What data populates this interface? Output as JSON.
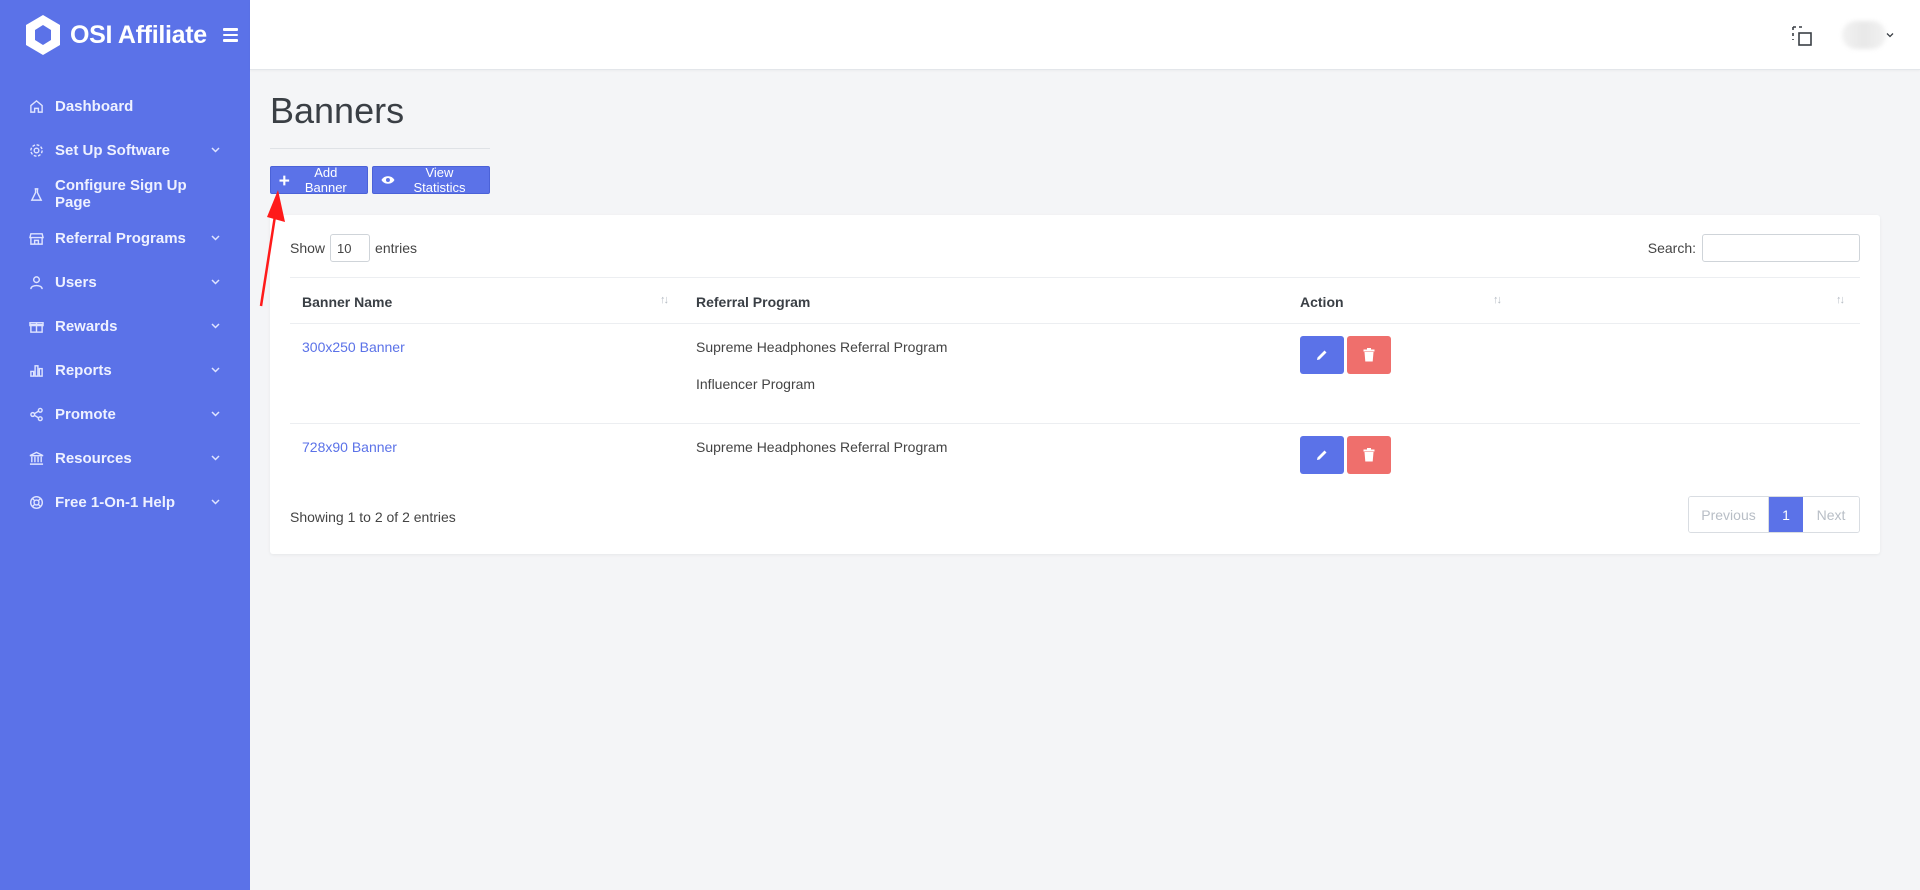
{
  "app": {
    "name": "OSI Affiliate"
  },
  "sidebar": {
    "items": [
      {
        "label": "Dashboard",
        "icon": "home-icon",
        "has_submenu": false
      },
      {
        "label": "Set Up Software",
        "icon": "gear-icon",
        "has_submenu": true
      },
      {
        "label": "Configure Sign Up Page",
        "icon": "flask-icon",
        "has_submenu": false
      },
      {
        "label": "Referral Programs",
        "icon": "store-icon",
        "has_submenu": true
      },
      {
        "label": "Users",
        "icon": "user-icon",
        "has_submenu": true
      },
      {
        "label": "Rewards",
        "icon": "gift-icon",
        "has_submenu": true
      },
      {
        "label": "Reports",
        "icon": "bar-chart-icon",
        "has_submenu": true
      },
      {
        "label": "Promote",
        "icon": "share-icon",
        "has_submenu": true
      },
      {
        "label": "Resources",
        "icon": "bank-icon",
        "has_submenu": true
      },
      {
        "label": "Free 1-On-1 Help",
        "icon": "lifebuoy-icon",
        "has_submenu": true
      }
    ]
  },
  "header": {
    "fullscreen_icon": "fullscreen-icon"
  },
  "main": {
    "title": "Banners",
    "buttons": {
      "add_banner": "Add Banner",
      "view_statistics": "View Statistics"
    },
    "table_controls": {
      "show_label": "Show",
      "entries_value": "10",
      "entries_label": "entries",
      "search_label": "Search:",
      "search_value": ""
    },
    "table": {
      "columns": [
        "Banner Name",
        "Referral Program",
        "Action"
      ],
      "rows": [
        {
          "banner_name": "300x250 Banner",
          "programs": [
            "Supreme Headphones Referral Program",
            "Influencer Program"
          ]
        },
        {
          "banner_name": "728x90 Banner",
          "programs": [
            "Supreme Headphones Referral Program"
          ]
        }
      ]
    },
    "footer": {
      "info": "Showing 1 to 2 of 2 entries",
      "pagination": {
        "previous": "Previous",
        "current": "1",
        "next": "Next"
      }
    }
  },
  "colors": {
    "accent": "#5b72e8",
    "danger": "#ef6f6c",
    "annotation_arrow": "#ff1a1a"
  }
}
